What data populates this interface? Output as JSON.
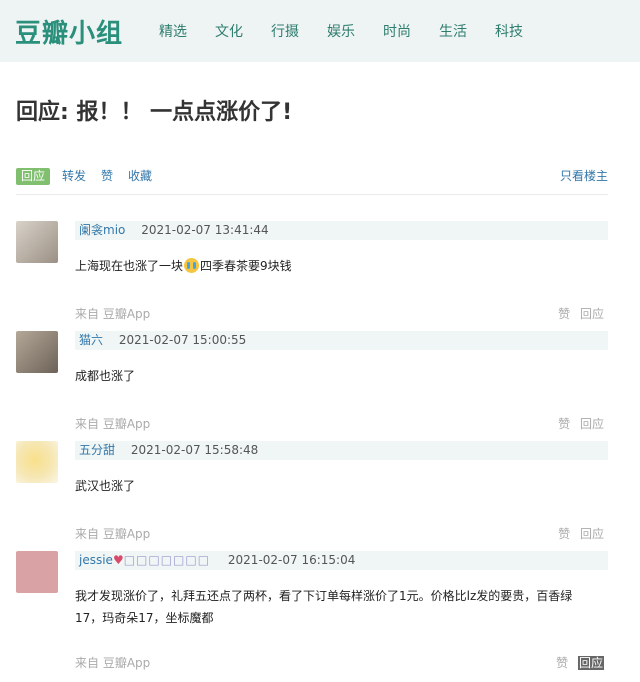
{
  "site": {
    "logo": "豆瓣小组",
    "nav": [
      "精选",
      "文化",
      "行摄",
      "娱乐",
      "时尚",
      "生活",
      "科技"
    ]
  },
  "page_title": "回应: 报！！ 一点点涨价了!",
  "actions": {
    "reply": "回应",
    "forward": "转发",
    "like": "赞",
    "collect": "收藏",
    "op_only": "只看楼主"
  },
  "comments": [
    {
      "author": "阑衾mio",
      "time": "2021-02-07 13:41:44",
      "text_before": "上海现在也涨了一块",
      "emoji": "crying-face",
      "text_after": "四季春茶要9块钱",
      "source": "来自 豆瓣App",
      "like": "赞",
      "reply": "回应",
      "avatar_color": "#b9b0a4"
    },
    {
      "author": "猫六",
      "time": "2021-02-07 15:00:55",
      "text": "成都也涨了",
      "source": "来自 豆瓣App",
      "like": "赞",
      "reply": "回应",
      "avatar_color": "#8a7d70"
    },
    {
      "author": "五分甜",
      "time": "2021-02-07 15:58:48",
      "text": "武汉也涨了",
      "source": "来自 豆瓣App",
      "like": "赞",
      "reply": "回应",
      "avatar_color": "#f6e7b5"
    },
    {
      "author": "jessie",
      "author_heart": "♥",
      "author_suffix": "□□□□□□□",
      "time": "2021-02-07 16:15:04",
      "text_line1": "我才发现涨价了，礼拜五还点了两杯，看了下订单每样涨价了1元。价格比lz发的要贵，百香绿",
      "text_line2": "17，玛奇朵17，坐标魔都",
      "source": "来自 豆瓣App",
      "like": "赞",
      "reply": "回应",
      "avatar_color": "#d9a3a6"
    }
  ]
}
